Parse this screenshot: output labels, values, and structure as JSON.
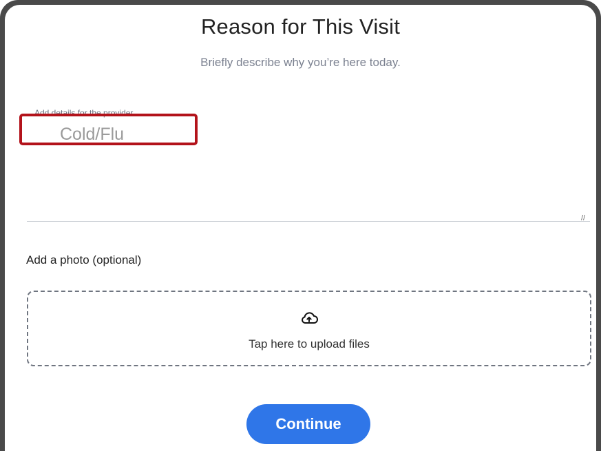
{
  "header": {
    "title": "Reason for This Visit",
    "subtitle": "Briefly describe why you’re here today."
  },
  "details_field": {
    "label": "Add details for the provider",
    "placeholder": "Cold/Flu",
    "value": ""
  },
  "photo": {
    "label": "Add a photo (optional)",
    "upload_text": "Tap here to upload files",
    "icon": "cloud-upload-icon"
  },
  "actions": {
    "continue_label": "Continue"
  },
  "colors": {
    "accent": "#2f76e8",
    "highlight": "#b3131b",
    "frame": "#4a4a4a"
  }
}
